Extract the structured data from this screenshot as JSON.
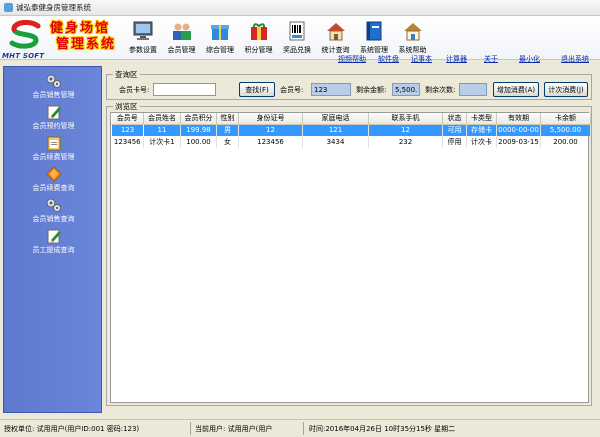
{
  "window": {
    "title": "诚弘泰健身房管理系统"
  },
  "logo": {
    "text": "MHT SOFT"
  },
  "brand": {
    "line1": "健身场馆",
    "line2": "管理系统"
  },
  "toolbar": [
    {
      "label": "参数设置",
      "icon": "monitor-icon"
    },
    {
      "label": "会员管理",
      "icon": "members-icon"
    },
    {
      "label": "综合管理",
      "icon": "gift-box-icon"
    },
    {
      "label": "积分管理",
      "icon": "gift-bag-icon"
    },
    {
      "label": "奖品兑换",
      "icon": "barcode-doc-icon"
    },
    {
      "label": "统计查询",
      "icon": "house-search-icon"
    },
    {
      "label": "系统管理",
      "icon": "book-icon"
    },
    {
      "label": "系统帮助",
      "icon": "help-house-icon"
    }
  ],
  "links": [
    "视频帮助",
    "软件盘",
    "记事本",
    "计算器",
    "关于",
    "最小化",
    "退出系统"
  ],
  "sidebar": [
    {
      "label": "会员销售管理",
      "icon": "gears-icon"
    },
    {
      "label": "会员预约管理",
      "icon": "pencil-doc-icon"
    },
    {
      "label": "会员续费管理",
      "icon": "clipboard-icon"
    },
    {
      "label": "会员续费查询",
      "icon": "orange-diamond-icon"
    },
    {
      "label": "会员销售查询",
      "icon": "gears-icon"
    },
    {
      "label": "员工提成查询",
      "icon": "pencil-doc-icon"
    }
  ],
  "query": {
    "group_title": "查询区",
    "card_label": "会员卡号:",
    "card_value": "",
    "search_button": "查找(F)",
    "member_no_label": "会员号:",
    "member_no_value": "123",
    "balance_label": "剩余金额:",
    "balance_value": "5,500.0",
    "remaining_label": "剩余次数:",
    "remaining_value": "",
    "add_button": "增加消费(A)",
    "count_button": "计次消费(J)"
  },
  "browse": {
    "group_title": "浏览区",
    "columns": [
      "会员号",
      "会员姓名",
      "会员积分",
      "性别",
      "身份证号",
      "家庭电话",
      "联系手机",
      "状态",
      "卡类型",
      "有效期",
      "卡余额"
    ],
    "rows": [
      [
        "123",
        "11",
        "199.98",
        "男",
        "12",
        "121",
        "12",
        "可用",
        "存储卡",
        "0000-00-00",
        "5,500.00"
      ],
      [
        "123456",
        "计次卡1",
        "100.00",
        "女",
        "123456",
        "3434",
        "232",
        "停用",
        "计次卡",
        "2009-03-15",
        "200.00"
      ]
    ]
  },
  "status": {
    "auth": "授权单位: 试用用户(用户ID:001 密码:123)",
    "current": "当前用户: 试用用户(用户",
    "time": "时间:2016年04月26日 10时35分15秒 星期二"
  },
  "colors": {
    "sidebar": "#6a86d8",
    "selection": "#3399ff",
    "link": "#0b2aa8"
  }
}
